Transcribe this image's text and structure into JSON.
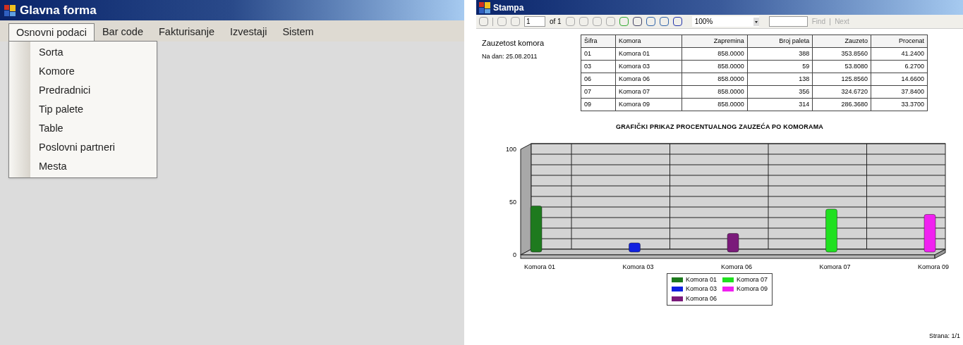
{
  "main_window": {
    "title": "Glavna forma",
    "menu": [
      {
        "label": "Osnovni podaci",
        "selected": true
      },
      {
        "label": "Bar code",
        "selected": false
      },
      {
        "label": "Fakturisanje",
        "selected": false
      },
      {
        "label": "Izvestaji",
        "selected": false
      },
      {
        "label": "Sistem",
        "selected": false
      }
    ],
    "dropdown": [
      "Sorta",
      "Komore",
      "Predradnici",
      "Tip palete",
      "Table",
      "Poslovni partneri",
      "Mesta"
    ]
  },
  "report_window": {
    "title": "Stampa",
    "toolbar": {
      "page": "1",
      "page_of": "of 1",
      "zoom": "100%",
      "find": "Find",
      "next": "Next"
    },
    "report": {
      "title": "Zauzetost komora",
      "date": "Na dan: 25.08.2011",
      "table": {
        "columns": [
          "Šifra",
          "Komora",
          "Zapremina",
          "Broj paleta",
          "Zauzeto",
          "Procenat"
        ],
        "rows": [
          [
            "01",
            "Komora 01",
            "858.0000",
            "388",
            "353.8560",
            "41.2400"
          ],
          [
            "03",
            "Komora 03",
            "858.0000",
            "59",
            "53.8080",
            "6.2700"
          ],
          [
            "06",
            "Komora 06",
            "858.0000",
            "138",
            "125.8560",
            "14.6600"
          ],
          [
            "07",
            "Komora 07",
            "858.0000",
            "356",
            "324.6720",
            "37.8400"
          ],
          [
            "09",
            "Komora 09",
            "858.0000",
            "314",
            "286.3680",
            "33.3700"
          ]
        ]
      },
      "chart_data": {
        "type": "bar",
        "title": "GRAFIČKI PRIKAZ PROCENTUALNOG ZAUZEĆA PO KOMORAMA",
        "categories": [
          "Komora 01",
          "Komora 03",
          "Komora 06",
          "Komora 07",
          "Komora 09"
        ],
        "ylim": [
          0,
          100
        ],
        "yticks": [
          0,
          50,
          100
        ],
        "series": [
          {
            "name": "Komora 01",
            "color": "#1e7a1e",
            "values": [
              41,
              null,
              null,
              null,
              null
            ]
          },
          {
            "name": "Komora 03",
            "color": "#1020e0",
            "values": [
              null,
              6,
              null,
              null,
              null
            ]
          },
          {
            "name": "Komora 06",
            "color": "#7a1a7a",
            "values": [
              null,
              null,
              15,
              null,
              null
            ]
          },
          {
            "name": "Komora 07",
            "color": "#20e020",
            "values": [
              null,
              null,
              null,
              38,
              null
            ]
          },
          {
            "name": "Komora 09",
            "color": "#f020f0",
            "values": [
              null,
              null,
              null,
              null,
              33
            ]
          }
        ]
      },
      "footer": "Strana: 1/1"
    }
  }
}
